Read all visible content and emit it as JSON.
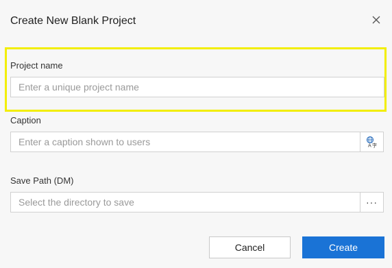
{
  "dialog": {
    "title": "Create New Blank Project",
    "close_icon": "close-icon"
  },
  "fields": {
    "project_name": {
      "label": "Project name",
      "value": "",
      "placeholder": "Enter a unique project name"
    },
    "caption": {
      "label": "Caption",
      "value": "",
      "placeholder": "Enter a caption shown to users",
      "side_icon": "translate-icon"
    },
    "save_path": {
      "label": "Save Path (DM)",
      "value": "",
      "placeholder": "Select the directory to save",
      "side_label": "···"
    }
  },
  "actions": {
    "cancel_label": "Cancel",
    "create_label": "Create"
  },
  "colors": {
    "primary": "#1a73d6",
    "highlight": "#f2ee00"
  }
}
